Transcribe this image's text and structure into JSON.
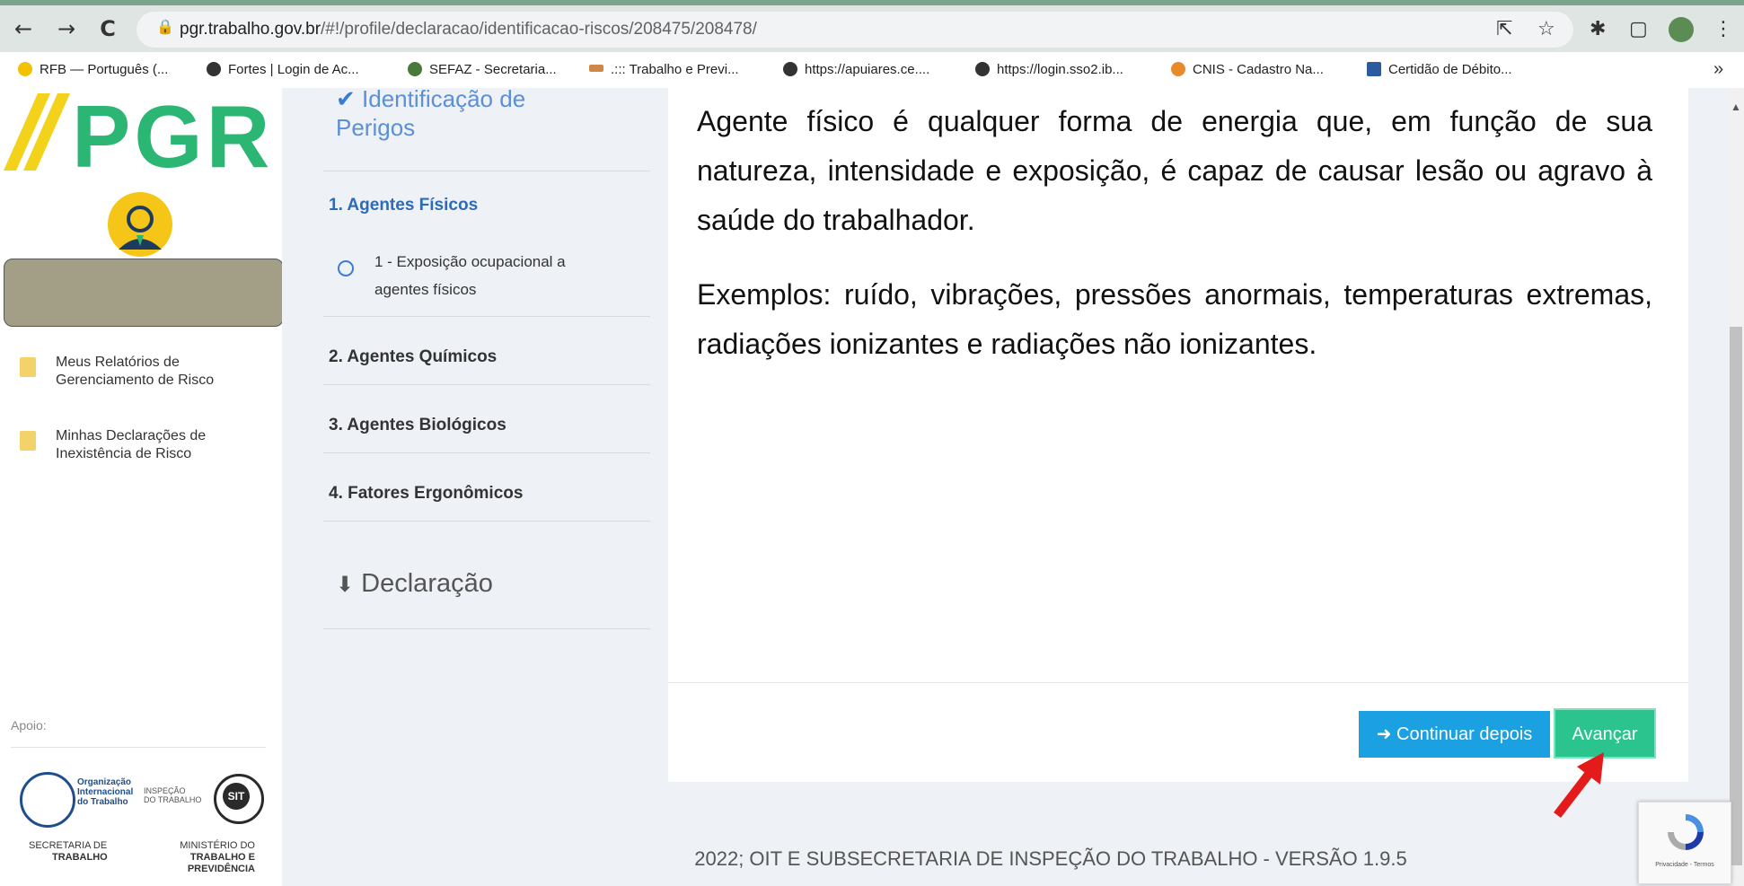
{
  "browser": {
    "url_host": "pgr.trabalho.gov.br",
    "url_path": "/#!/profile/declaracao/identificacao-riscos/208475/208478/",
    "bookmarks": [
      {
        "label": "RFB — Português (...",
        "color": "#f2c200"
      },
      {
        "label": "Fortes | Login de Ac...",
        "color": "#333333"
      },
      {
        "label": "SEFAZ - Secretaria...",
        "color": "#4a7a3a"
      },
      {
        "label": ".::: Trabalho e Previ...",
        "color": "#c84"
      },
      {
        "label": "https://apuiares.ce....",
        "color": "#333333"
      },
      {
        "label": "https://login.sso2.ib...",
        "color": "#333333"
      },
      {
        "label": "CNIS - Cadastro Na...",
        "color": "#e88a2a"
      },
      {
        "label": "Certidão de Débito...",
        "color": "#2a5aa0"
      }
    ],
    "bookmarks_more": "»",
    "icons": {
      "back": "←",
      "forward": "→",
      "reload": "C",
      "share": "⇱",
      "star": "☆",
      "extensions": "✱",
      "sidepanel": "▢",
      "menu": "⋮"
    }
  },
  "sidebar": {
    "logo": "PGR",
    "items": [
      {
        "line1": "Meus Relatórios de",
        "line2": "Gerenciamento de Risco"
      },
      {
        "line1": "Minhas Declarações de",
        "line2": "Inexistência de Risco"
      }
    ],
    "apoio": "Apoio:",
    "oit": {
      "line1": "Organização",
      "line2": "Internacional",
      "line3": "do Trabalho"
    },
    "inspecao": {
      "line1": "INSPEÇÃO",
      "line2": "DO TRABALHO"
    },
    "sit": "SIT",
    "sec_left": {
      "line1": "SECRETARIA DE",
      "line2": "TRABALHO"
    },
    "sec_right": {
      "line1": "MINISTÉRIO DO",
      "line2": "TRABALHO E PREVIDÊNCIA"
    }
  },
  "steps": {
    "title_line1": "Identificação de",
    "title_line2": "Perigos",
    "step1": "1. Agentes Físicos",
    "sub1_line1": "1 - Exposição ocupacional a",
    "sub1_line2": "agentes físicos",
    "step2": "2. Agentes Químicos",
    "step3": "3. Agentes Biológicos",
    "step4": "4. Fatores Ergonômicos",
    "declaracao": "Declaração"
  },
  "content": {
    "paragraph1": "Agente físico é qualquer forma de energia que, em função de sua natureza, intensidade e exposição, é capaz de causar lesão ou agravo à saúde do trabalhador.",
    "paragraph2": "Exemplos: ruído, vibrações, pressões anormais, temperaturas extremas, radiações ionizantes e radiações não ionizantes."
  },
  "buttons": {
    "continue_later": "Continuar depois",
    "advance": "Avançar"
  },
  "footer": {
    "copyright": "2022; OIT E SUBSECRETARIA DE INSPEÇÃO DO TRABALHO - VERSÃO 1.9.5"
  },
  "recaptcha": {
    "text": "Privacidade - Termos"
  }
}
